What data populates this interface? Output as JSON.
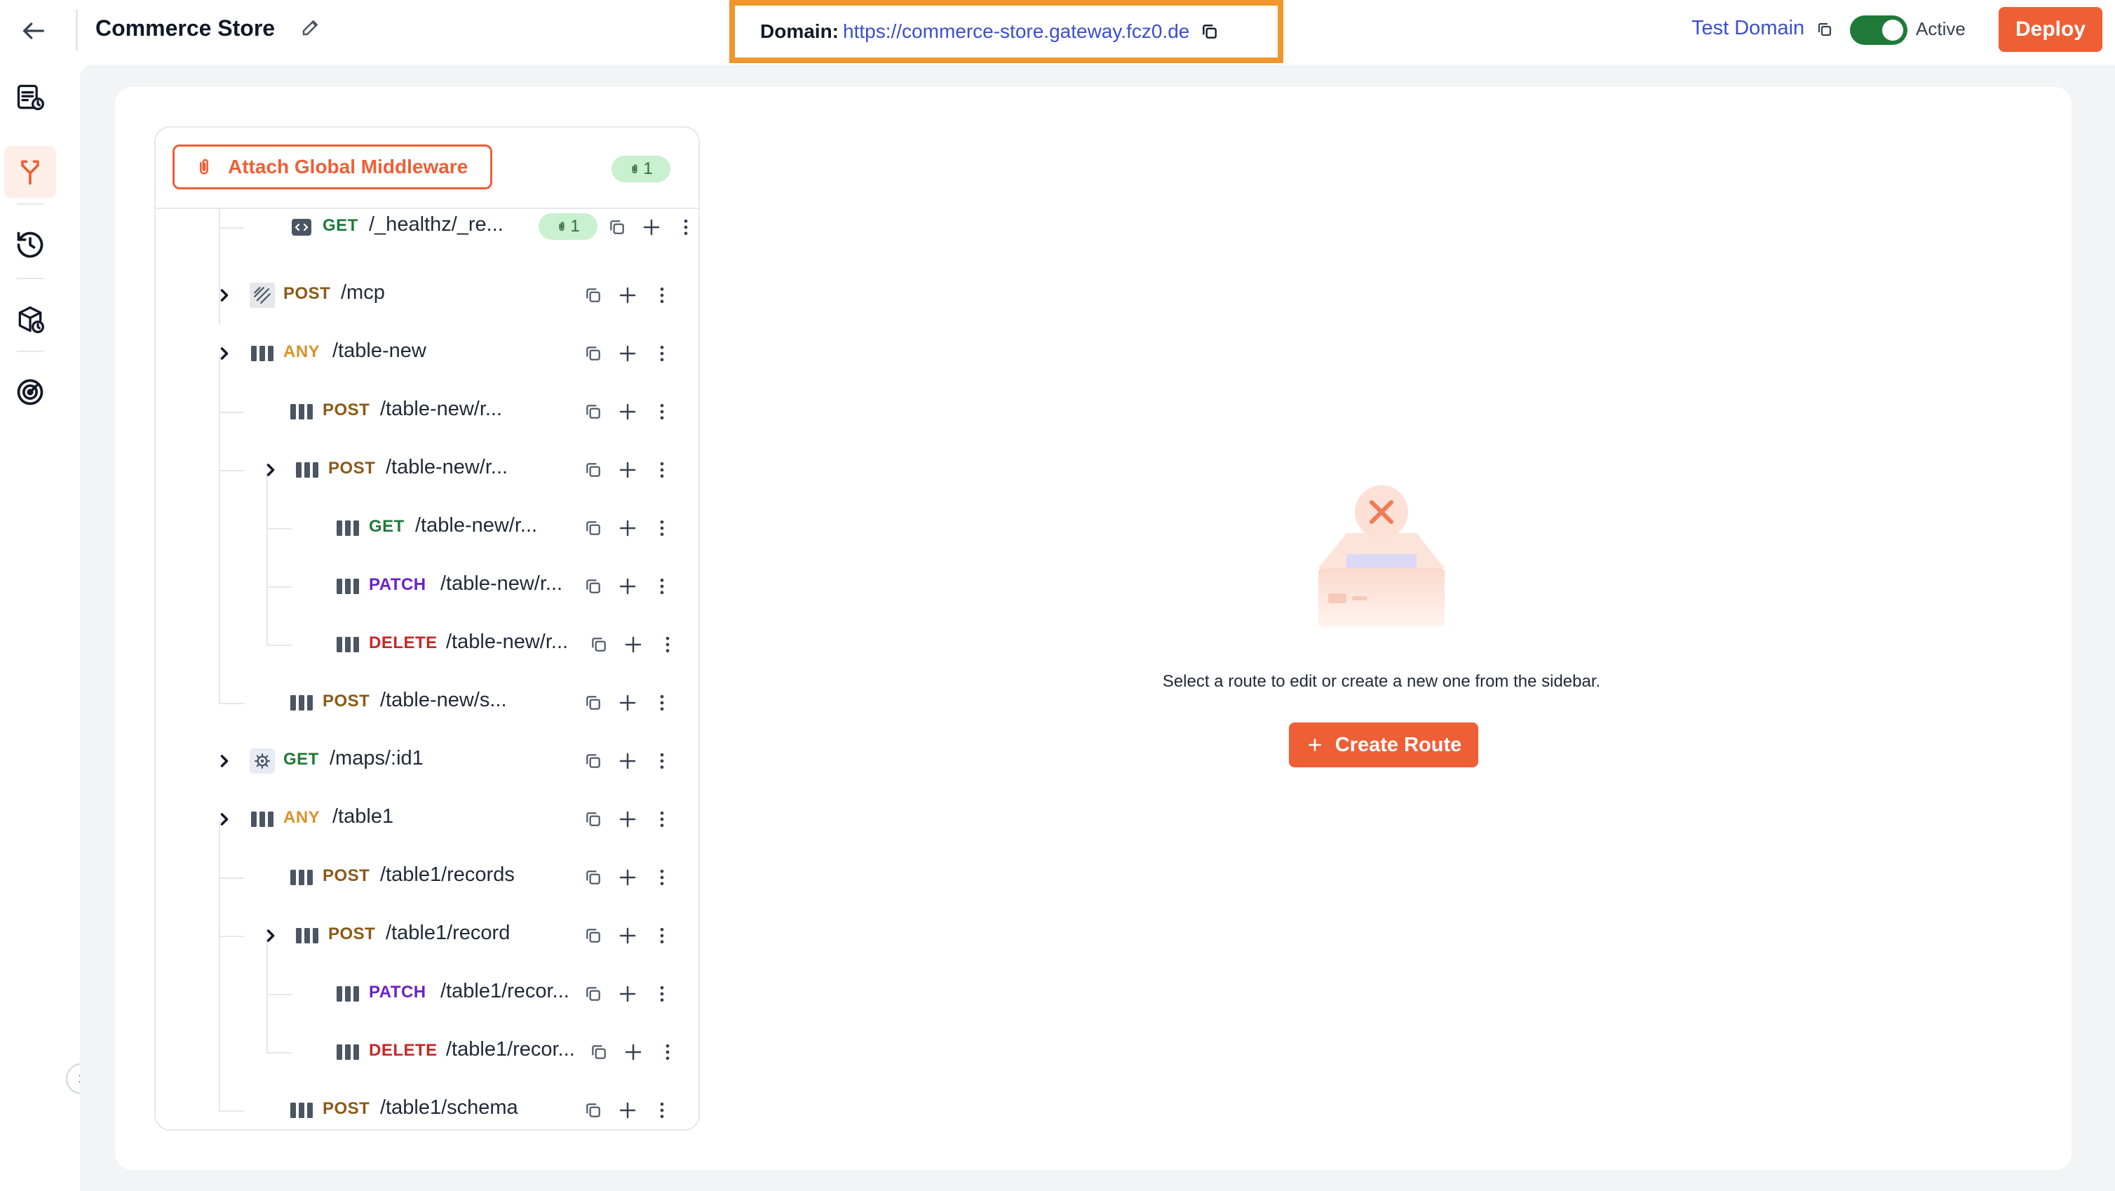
{
  "header": {
    "title": "Commerce Store",
    "domain_label": "Domain:",
    "domain_url": "https://commerce-store.gateway.fcz0.de",
    "test_domain_label": "Test Domain",
    "status_label": "Active",
    "status_active": true,
    "deploy_label": "Deploy"
  },
  "sidebar": {
    "items": [
      {
        "icon": "logs-icon",
        "active": false
      },
      {
        "icon": "routes-icon",
        "active": true
      },
      {
        "icon": "history-icon",
        "active": false
      },
      {
        "icon": "packages-icon",
        "active": false
      },
      {
        "icon": "analytics-icon",
        "active": false
      }
    ]
  },
  "tree": {
    "attach_label": "Attach Global Middleware",
    "middleware_count": "1",
    "routes": [
      {
        "method": "GET",
        "path": "/_healthz/_re...",
        "icon": "code-icon",
        "depth": 1,
        "expandable": false,
        "badge": "1"
      },
      {
        "method": "POST",
        "path": "/mcp",
        "icon": "mcp-icon",
        "depth": 0,
        "expandable": true
      },
      {
        "method": "ANY",
        "path": "/table-new",
        "icon": "table-icon",
        "depth": 0,
        "expandable": true
      },
      {
        "method": "POST",
        "path": "/table-new/r...",
        "icon": "table-icon",
        "depth": 1,
        "expandable": false
      },
      {
        "method": "POST",
        "path": "/table-new/r...",
        "icon": "table-icon",
        "depth": 1,
        "expandable": true
      },
      {
        "method": "GET",
        "path": "/table-new/r...",
        "icon": "table-icon",
        "depth": 2,
        "expandable": false
      },
      {
        "method": "PATCH",
        "path": "/table-new/r...",
        "icon": "table-icon",
        "depth": 2,
        "expandable": false
      },
      {
        "method": "DELETE",
        "path": "/table-new/r...",
        "icon": "table-icon",
        "depth": 2,
        "expandable": false
      },
      {
        "method": "POST",
        "path": "/table-new/s...",
        "icon": "table-icon",
        "depth": 1,
        "expandable": false
      },
      {
        "method": "GET",
        "path": "/maps/:id1",
        "icon": "gear-icon",
        "depth": 0,
        "expandable": true
      },
      {
        "method": "ANY",
        "path": "/table1",
        "icon": "table-icon",
        "depth": 0,
        "expandable": true
      },
      {
        "method": "POST",
        "path": "/table1/records",
        "icon": "table-icon",
        "depth": 1,
        "expandable": false
      },
      {
        "method": "POST",
        "path": "/table1/record",
        "icon": "table-icon",
        "depth": 1,
        "expandable": true
      },
      {
        "method": "PATCH",
        "path": "/table1/recor...",
        "icon": "table-icon",
        "depth": 2,
        "expandable": false
      },
      {
        "method": "DELETE",
        "path": "/table1/recor...",
        "icon": "table-icon",
        "depth": 2,
        "expandable": false
      },
      {
        "method": "POST",
        "path": "/table1/schema",
        "icon": "table-icon",
        "depth": 1,
        "expandable": false
      }
    ]
  },
  "empty_state": {
    "message": "Select a route to edit or create a new one from the sidebar.",
    "create_label": "Create Route"
  },
  "colors": {
    "accent": "#ee5f36",
    "highlight_border": "#f0962a",
    "link": "#3b4fc9",
    "toggle_on": "#1f7a3a",
    "badge_bg": "#c9f0cf"
  }
}
